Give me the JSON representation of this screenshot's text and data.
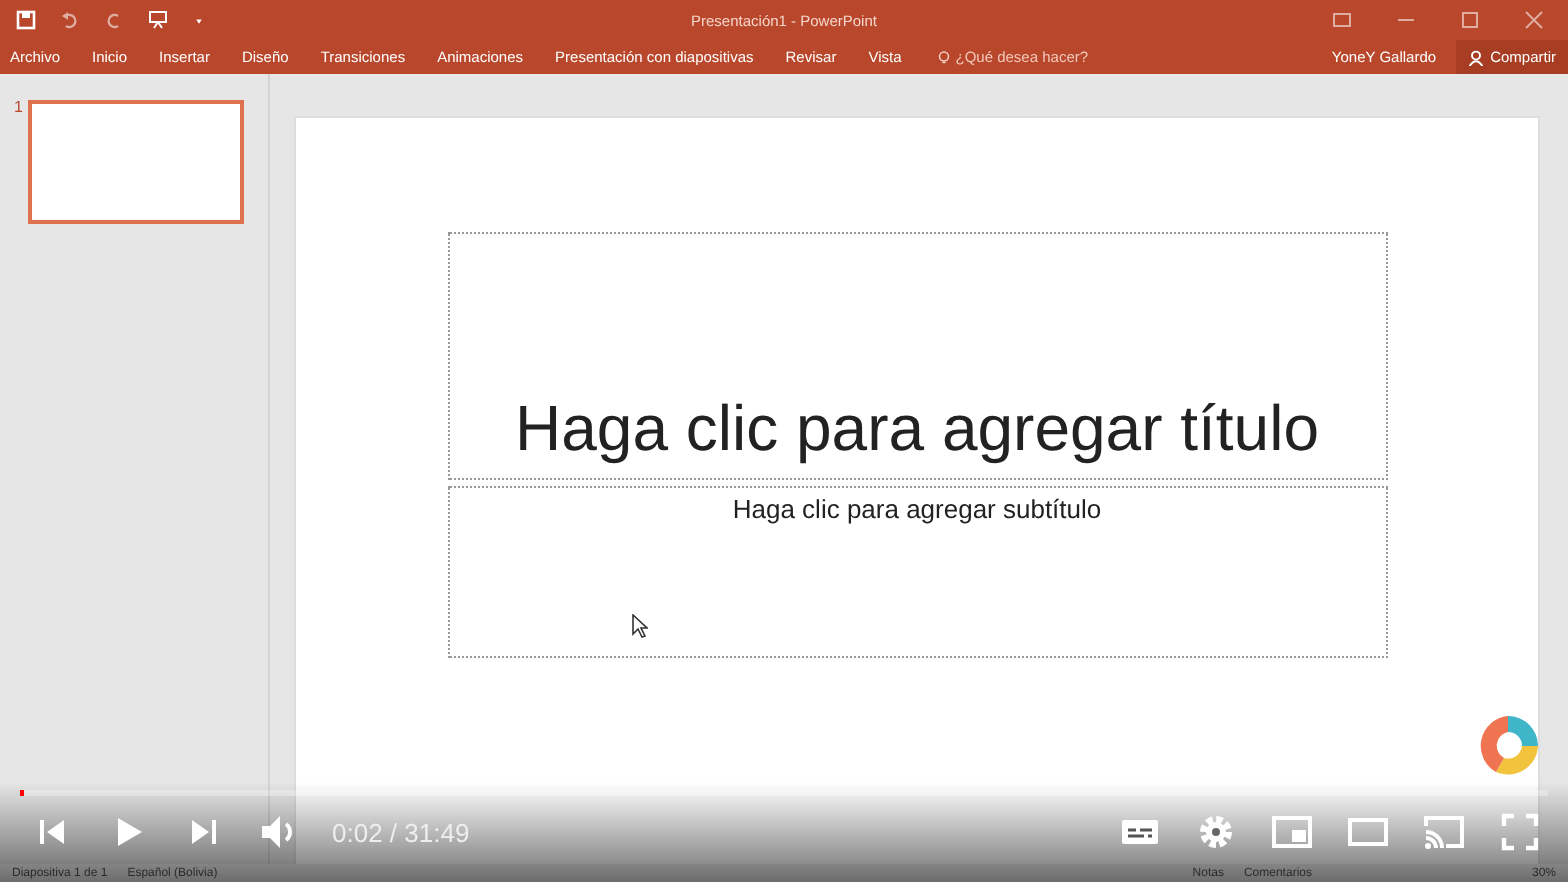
{
  "window": {
    "title": "Presentación1 - PowerPoint"
  },
  "tabs": [
    {
      "label": "Archivo",
      "selected": false
    },
    {
      "label": "Inicio",
      "selected": false
    },
    {
      "label": "Insertar",
      "selected": false
    },
    {
      "label": "Diseño",
      "selected": false
    },
    {
      "label": "Transiciones",
      "selected": false
    },
    {
      "label": "Animaciones",
      "selected": false
    },
    {
      "label": "Presentación con diapositivas",
      "selected": false
    },
    {
      "label": "Revisar",
      "selected": false
    },
    {
      "label": "Vista",
      "selected": false
    }
  ],
  "tell_me": {
    "placeholder": "¿Qué desea hacer?"
  },
  "user": "YoneY Gallardo",
  "share": "Compartir",
  "thumbnails": [
    {
      "number": "1",
      "selected": true
    }
  ],
  "slide": {
    "title_placeholder": "Haga clic para agregar título",
    "subtitle_placeholder": "Haga clic para agregar subtítulo"
  },
  "status_bar": {
    "slide_info": "Diapositiva 1 de 1",
    "language": "Español (Bolivia)",
    "notes": "Notas",
    "comments": "Comentarios",
    "zoom": "30%"
  },
  "player": {
    "time": "0:02 / 31:49",
    "level": 0.003
  }
}
